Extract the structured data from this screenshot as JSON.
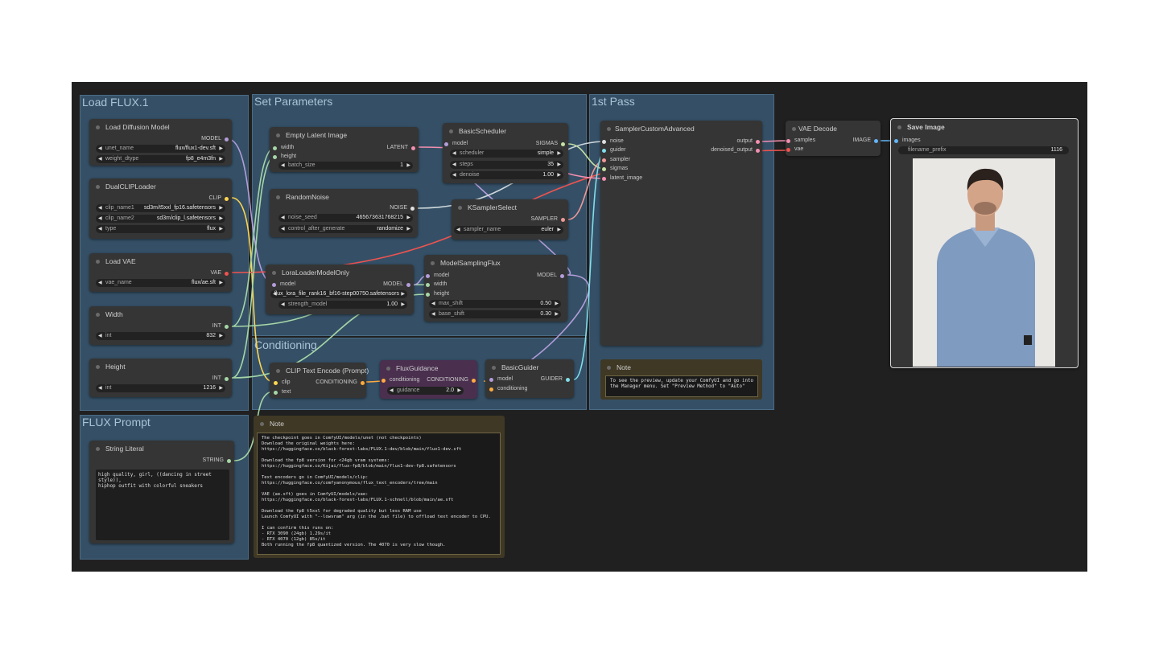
{
  "groups": {
    "load_flux": "Load FLUX.1",
    "set_parameters": "Set Parameters",
    "first_pass": "1st Pass",
    "conditioning": "Conditioning",
    "flux_prompt": "FLUX Prompt"
  },
  "nodes": {
    "load_diffusion_model": {
      "title": "Load Diffusion Model",
      "out_model": "MODEL",
      "unet_name_label": "unet_name",
      "unet_name_value": "flux/flux1-dev.sft",
      "weight_dtype_label": "weight_dtype",
      "weight_dtype_value": "fp8_e4m3fn"
    },
    "dual_clip_loader": {
      "title": "DualCLIPLoader",
      "out_clip": "CLIP",
      "clip_name1_label": "clip_name1",
      "clip_name1_value": "sd3m/t5xxl_fp16.safetensors",
      "clip_name2_label": "clip_name2",
      "clip_name2_value": "sd3m/clip_l.safetensors",
      "type_label": "type",
      "type_value": "flux"
    },
    "load_vae": {
      "title": "Load VAE",
      "out_vae": "VAE",
      "vae_name_label": "vae_name",
      "vae_name_value": "flux/ae.sft"
    },
    "width": {
      "title": "Width",
      "out": "INT",
      "int_label": "int",
      "int_value": "832"
    },
    "height": {
      "title": "Height",
      "out": "INT",
      "int_label": "int",
      "int_value": "1216"
    },
    "empty_latent": {
      "title": "Empty Latent Image",
      "in_width": "width",
      "in_height": "height",
      "out": "LATENT",
      "batch_label": "batch_size",
      "batch_value": "1"
    },
    "random_noise": {
      "title": "RandomNoise",
      "out": "NOISE",
      "seed_label": "noise_seed",
      "seed_value": "465673631768215",
      "control_label": "control_after_generate",
      "control_value": "randomize"
    },
    "lora_loader": {
      "title": "LoraLoaderModelOnly",
      "in_model": "model",
      "out": "MODEL",
      "lora_value": "flux_lora_file_rank16_bf16-step00750.safetensors",
      "strength_label": "strength_model",
      "strength_value": "1.00"
    },
    "basic_scheduler": {
      "title": "BasicScheduler",
      "in_model": "model",
      "out": "SIGMAS",
      "scheduler_label": "scheduler",
      "scheduler_value": "simple",
      "steps_label": "steps",
      "steps_value": "35",
      "denoise_label": "denoise",
      "denoise_value": "1.00"
    },
    "ksampler_select": {
      "title": "KSamplerSelect",
      "out": "SAMPLER",
      "sampler_label": "sampler_name",
      "sampler_value": "euler"
    },
    "model_sampling_flux": {
      "title": "ModelSamplingFlux",
      "in_model": "model",
      "in_width": "width",
      "in_height": "height",
      "out": "MODEL",
      "max_shift_label": "max_shift",
      "max_shift_value": "0.50",
      "base_shift_label": "base_shift",
      "base_shift_value": "0.30"
    },
    "clip_text_encode": {
      "title": "CLIP Text Encode (Prompt)",
      "in_clip": "clip",
      "in_text": "text",
      "out": "CONDITIONING"
    },
    "flux_guidance": {
      "title": "FluxGuidance",
      "in_cond": "conditioning",
      "out": "CONDITIONING",
      "guidance_label": "guidance",
      "guidance_value": "2.0"
    },
    "basic_guider": {
      "title": "BasicGuider",
      "in_model": "model",
      "in_cond": "conditioning",
      "out": "GUIDER"
    },
    "sampler_custom_advanced": {
      "title": "SamplerCustomAdvanced",
      "in_noise": "noise",
      "in_guider": "guider",
      "in_sampler": "sampler",
      "in_sigmas": "sigmas",
      "in_latent": "latent_image",
      "out_output": "output",
      "out_denoised": "denoised_output"
    },
    "vae_decode": {
      "title": "VAE Decode",
      "in_samples": "samples",
      "in_vae": "vae",
      "out": "IMAGE"
    },
    "save_image": {
      "title": "Save Image",
      "in_images": "images",
      "prefix_label": "filename_prefix",
      "prefix_value": "1116"
    },
    "note_preview": {
      "title": "Note",
      "text": "To see the preview, update your ComfyUI and go into\nthe Manager menu. Set \"Preview Method\" to \"Auto\""
    },
    "string_literal": {
      "title": "String Literal",
      "out": "STRING",
      "text": "high quality, girl, ((dancing in street style)),\nhiphop outfit with colorful sneakers"
    },
    "note_main": {
      "title": "Note",
      "text": "The checkpoint goes in ComfyUI/models/unet (not checkpoints)\nDownload the original weights here:\nhttps://huggingface.co/black-forest-labs/FLUX.1-dev/blob/main/flux1-dev.sft\n\nDownload the fp8 version for <24gb vram systems:\nhttps://huggingface.co/Kijai/flux-fp8/blob/main/flux1-dev-fp8.safetensors\n\nText encoders go in ComfyUI/models/clip:\nhttps://huggingface.co/comfyanonymous/flux_text_encoders/tree/main\n\nVAE (ae.sft) goes in ComfyUI/models/vae:\nhttps://huggingface.co/black-forest-labs/FLUX.1-schnell/blob/main/ae.sft\n\nDownload the fp8 t5xxl for degraded quality but less RAM use\nLaunch ComfyUI with \"--lowvram\" arg (in the .bat file) to offload text encoder to CPU.\n\nI can confirm this runs on:\n- RTX 3090 (24gb) 1.29s/it\n- RTX 4070 (12gb) 85s/it\nBoth running the fp8 quantized version. The 4070 is very slow though."
    }
  },
  "colors": {
    "model": "#b39ddb",
    "clip": "#ffd54f",
    "vae": "#ef5350",
    "int": "#a5d6a7",
    "latent": "#f48fb1",
    "conditioning": "#ffab40",
    "noise": "#e0e0e0",
    "sigmas": "#c5e1a5",
    "sampler": "#ef9a9a",
    "guider": "#80deea",
    "image": "#64b5f6",
    "string": "#a5d6a7"
  }
}
